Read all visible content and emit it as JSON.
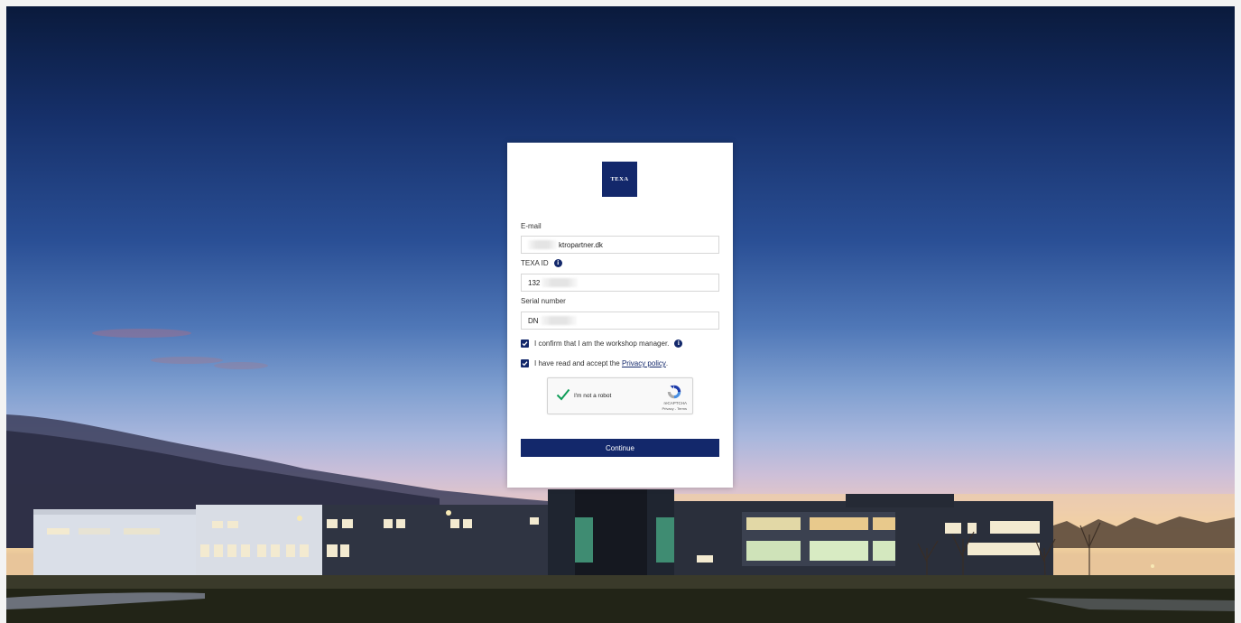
{
  "brand": {
    "logo_text": "TEXA",
    "color": "#13286b"
  },
  "form": {
    "email": {
      "label": "E-mail",
      "value_visible": "ktropartner.dk"
    },
    "texa_id": {
      "label": "TEXA ID",
      "info_icon": "info-icon",
      "value_visible": "132"
    },
    "serial_number": {
      "label": "Serial number",
      "value_visible": "DN"
    },
    "confirm_manager": {
      "checked": true,
      "label": "I confirm that I am the workshop manager.",
      "info_icon": "info-icon"
    },
    "privacy": {
      "checked": true,
      "label_prefix": "I have read and accept the ",
      "link_text": "Privacy policy",
      "label_suffix": "."
    },
    "recaptcha": {
      "label": "I'm not a robot",
      "brand": "reCAPTCHA",
      "terms": "Privacy - Terms",
      "verified": true
    },
    "submit_label": "Continue"
  }
}
